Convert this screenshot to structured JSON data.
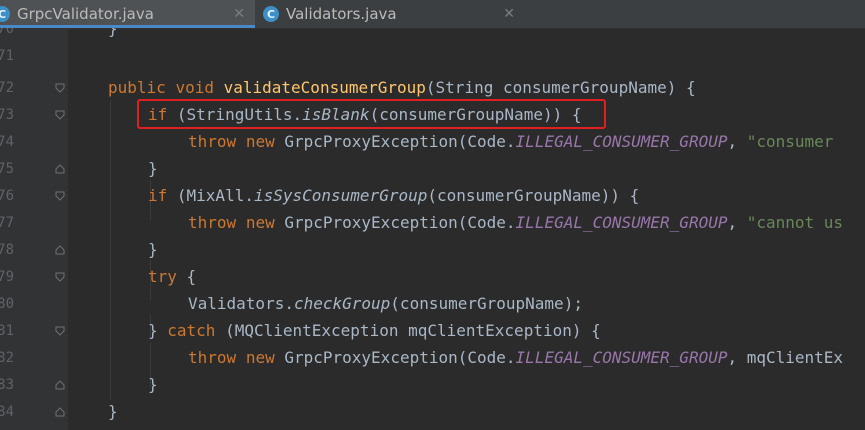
{
  "tabs": [
    {
      "label": "GrpcValidator.java",
      "icon": "java-class-icon",
      "icon_letter": "C",
      "close": "✕",
      "active": true
    },
    {
      "label": "Validators.java",
      "icon": "java-class-icon",
      "icon_letter": "C",
      "close": "✕",
      "active": false
    }
  ],
  "line_numbers": [
    "70",
    "71",
    "72",
    "73",
    "74",
    "75",
    "76",
    "77",
    "78",
    "79",
    "80",
    "81",
    "82",
    "83",
    "84"
  ],
  "code": {
    "l70": "}",
    "l72_kw1": "public",
    "l72_kw2": "void",
    "l72_fn": "validateConsumerGroup",
    "l72_rest": "(String consumerGroupName) {",
    "l73_kw": "if",
    "l73_a": " (StringUtils.",
    "l73_m": "isBlank",
    "l73_b": "(consumerGroupName)) {",
    "l74_kw1": "throw",
    "l74_kw2": "new",
    "l74_a": " GrpcProxyException(Code.",
    "l74_c": "ILLEGAL_CONSUMER_GROUP",
    "l74_b": ", ",
    "l74_s": "\"consumer",
    "l75": "}",
    "l76_kw": "if",
    "l76_a": " (MixAll.",
    "l76_m": "isSysConsumerGroup",
    "l76_b": "(consumerGroupName)) {",
    "l77_kw1": "throw",
    "l77_kw2": "new",
    "l77_a": " GrpcProxyException(Code.",
    "l77_c": "ILLEGAL_CONSUMER_GROUP",
    "l77_b": ", ",
    "l77_s": "\"cannot us",
    "l78": "}",
    "l79_kw": "try",
    "l79_b": " {",
    "l80_a": "Validators.",
    "l80_m": "checkGroup",
    "l80_b": "(consumerGroupName);",
    "l81_a": "} ",
    "l81_kw": "catch",
    "l81_b": " (MQClientException mqClientException) {",
    "l82_kw1": "throw",
    "l82_kw2": "new",
    "l82_a": " GrpcProxyException(Code.",
    "l82_c": "ILLEGAL_CONSUMER_GROUP",
    "l82_b": ", mqClientEx",
    "l83": "}",
    "l84": "}"
  },
  "colors": {
    "background": "#2b2b2b",
    "keyword": "#cc7832",
    "method": "#ffc66d",
    "constant": "#9876aa",
    "string": "#6a8759",
    "highlight_box": "#e02020",
    "tab_underline": "#4a88c7"
  }
}
